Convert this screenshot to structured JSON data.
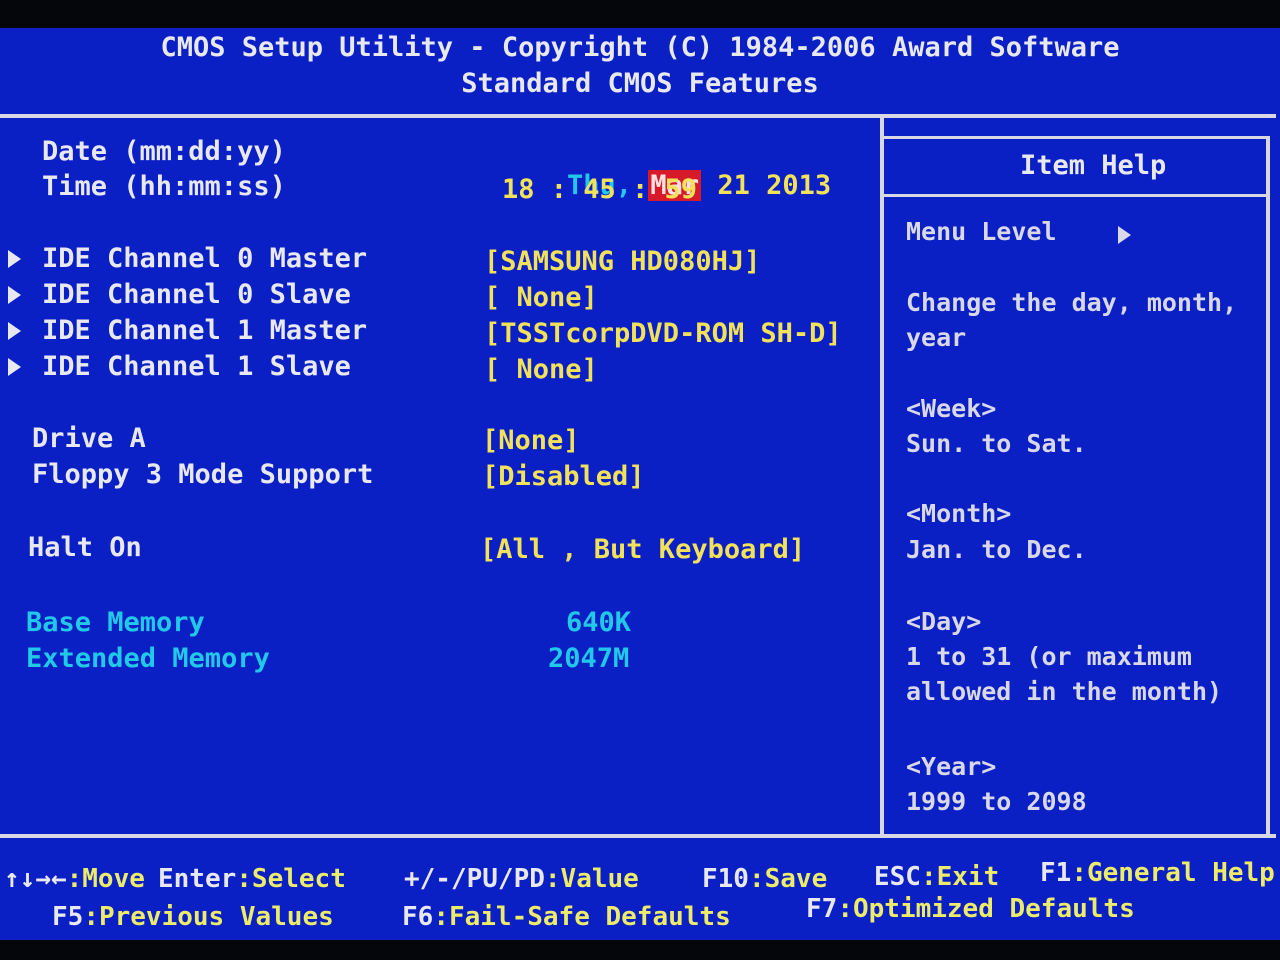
{
  "header": {
    "title": "CMOS Setup Utility - Copyright (C) 1984-2006 Award Software",
    "subtitle": "Standard CMOS Features"
  },
  "settings": {
    "date": {
      "label": "Date (mm:dd:yy)",
      "weekday": "Thu,",
      "month": "Mar",
      "day_year": "21 2013"
    },
    "time": {
      "label": "Time (hh:mm:ss)",
      "value": "18 : 45 : 59"
    },
    "ide": [
      {
        "label": "IDE Channel 0 Master",
        "value": "[SAMSUNG HD080HJ]"
      },
      {
        "label": "IDE Channel 0 Slave",
        "value": "[ None]"
      },
      {
        "label": "IDE Channel 1 Master",
        "value": "[TSSTcorpDVD-ROM SH-D]"
      },
      {
        "label": "IDE Channel 1 Slave",
        "value": "[ None]"
      }
    ],
    "drive_a": {
      "label": "Drive A",
      "value": "[None]"
    },
    "floppy": {
      "label": "Floppy 3 Mode Support",
      "value": "[Disabled]"
    },
    "halt_on": {
      "label": "Halt On",
      "value": "[All , But Keyboard]"
    },
    "base_memory": {
      "label": "Base Memory",
      "value": "640K"
    },
    "extended_memory": {
      "label": "Extended Memory",
      "value": "2047M"
    }
  },
  "help": {
    "title": "Item Help",
    "menu_level": "Menu Level",
    "lines": [
      "Change the day, month,",
      "year",
      "<Week>",
      "Sun. to Sat.",
      "<Month>",
      "Jan. to Dec.",
      "<Day>",
      "1 to 31 (or maximum",
      "allowed in the month)",
      "<Year>",
      "1999 to 2098"
    ]
  },
  "footer": {
    "row1": [
      {
        "key": "↑↓→←",
        "action": ":Move"
      },
      {
        "key": "Enter",
        "action": ":Select"
      },
      {
        "key": "+/-/PU/PD",
        "action": ":Value"
      },
      {
        "key": "F10",
        "action": ":Save"
      },
      {
        "key": "ESC",
        "action": ":Exit"
      },
      {
        "key": "F1",
        "action": ":General Help"
      }
    ],
    "row2": [
      {
        "key": "F5",
        "action": ":Previous Values"
      },
      {
        "key": "F6",
        "action": ":Fail-Safe Defaults"
      },
      {
        "key": "F7",
        "action": ":Optimized Defaults"
      }
    ]
  },
  "colors": {
    "background": "#0a1fc4",
    "label": "#e8e8f2",
    "value": "#f2e25a",
    "info": "#22c8e8",
    "selection": "#d61a2a"
  }
}
